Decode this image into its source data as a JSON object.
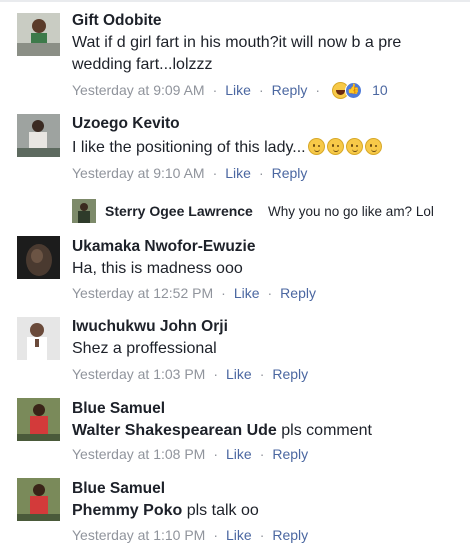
{
  "comments": [
    {
      "avatar": "avatar-gift",
      "name": "Gift Odobite",
      "text_lines": [
        "Wat if d girl fart in his mouth?it will now b a pre",
        "wedding fart...lolzzz"
      ],
      "time": "Yesterday at 9:09 AM",
      "like": "Like",
      "reply": "Reply",
      "reaction_count": "10"
    },
    {
      "avatar": "avatar-uzoego",
      "name": "Uzoego Kevito",
      "text": "I like the positioning of this lady...",
      "emoji_icon": "wink-emoji-icon",
      "emoji_count": 4,
      "time": "Yesterday at 9:10 AM",
      "like": "Like",
      "reply": "Reply"
    },
    {
      "avatar": "avatar-sterry",
      "name": "Sterry Ogee Lawrence",
      "text": "Why you no go like am? Lol"
    },
    {
      "avatar": "avatar-ukamaka",
      "name": "Ukamaka Nwofor-Ewuzie",
      "text": "Ha, this is madness ooo",
      "time": "Yesterday at 12:52 PM",
      "like": "Like",
      "reply": "Reply"
    },
    {
      "avatar": "avatar-iwuchukwu",
      "name": "Iwuchukwu John Orji",
      "text": "Shez a proffessional",
      "time": "Yesterday at 1:03 PM",
      "like": "Like",
      "reply": "Reply"
    },
    {
      "avatar": "avatar-blue",
      "name": "Blue Samuel",
      "mention": "Walter Shakespearean Ude",
      "text": "pls comment",
      "time": "Yesterday at 1:08 PM",
      "like": "Like",
      "reply": "Reply"
    },
    {
      "avatar": "avatar-blue",
      "name": "Blue Samuel",
      "mention": "Phemmy Poko",
      "text": "pls talk oo",
      "time": "Yesterday at 1:10 PM",
      "like": "Like",
      "reply": "Reply"
    }
  ],
  "meta_separator": "·",
  "colors": {
    "link": "#4b67a1",
    "meta": "#90949c",
    "text": "#1d2129"
  }
}
